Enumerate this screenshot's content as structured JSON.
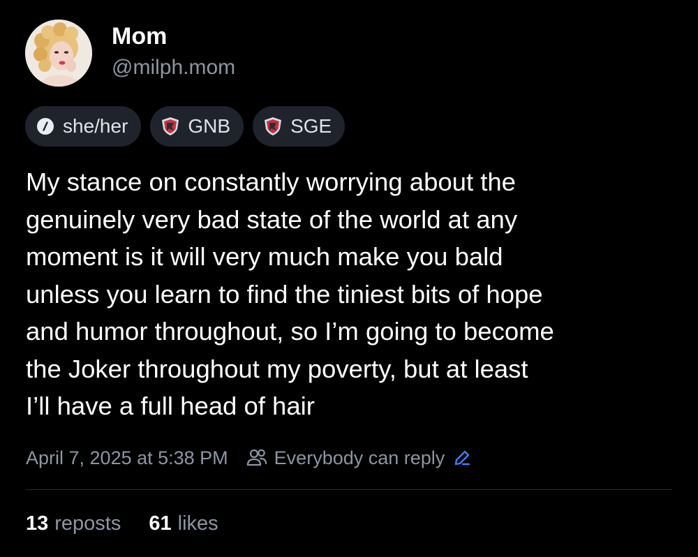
{
  "author": {
    "display_name": "Mom",
    "handle": "@milph.mom",
    "avatar": "avatar-photo"
  },
  "badges": [
    {
      "icon": "pronoun-icon",
      "label": "she/her"
    },
    {
      "icon": "shield-badge-icon",
      "label": "GNB"
    },
    {
      "icon": "shield-badge-icon",
      "label": "SGE"
    }
  ],
  "post": {
    "text": "My stance on constantly worrying about the\ngenuinely very bad state of the world at any\nmoment is it will very much make you bald\nunless you learn to find the tiniest bits of hope\nand humor throughout, so I’m going to become\nthe Joker throughout my poverty, but at least\nI’ll have a full head of hair",
    "timestamp": "April 7, 2025 at 5:38 PM",
    "reply_setting": "Everybody can reply",
    "reply_icon": "people-icon",
    "edit_icon": "pencil-icon"
  },
  "stats": {
    "reposts_count": "13",
    "reposts_label": "reposts",
    "likes_count": "61",
    "likes_label": "likes"
  },
  "colors": {
    "background": "#000000",
    "text": "#ffffff",
    "muted": "#8d96a5",
    "chip": "#1f232b",
    "accent": "#3b82f6",
    "badge_red": "#c9303f"
  }
}
